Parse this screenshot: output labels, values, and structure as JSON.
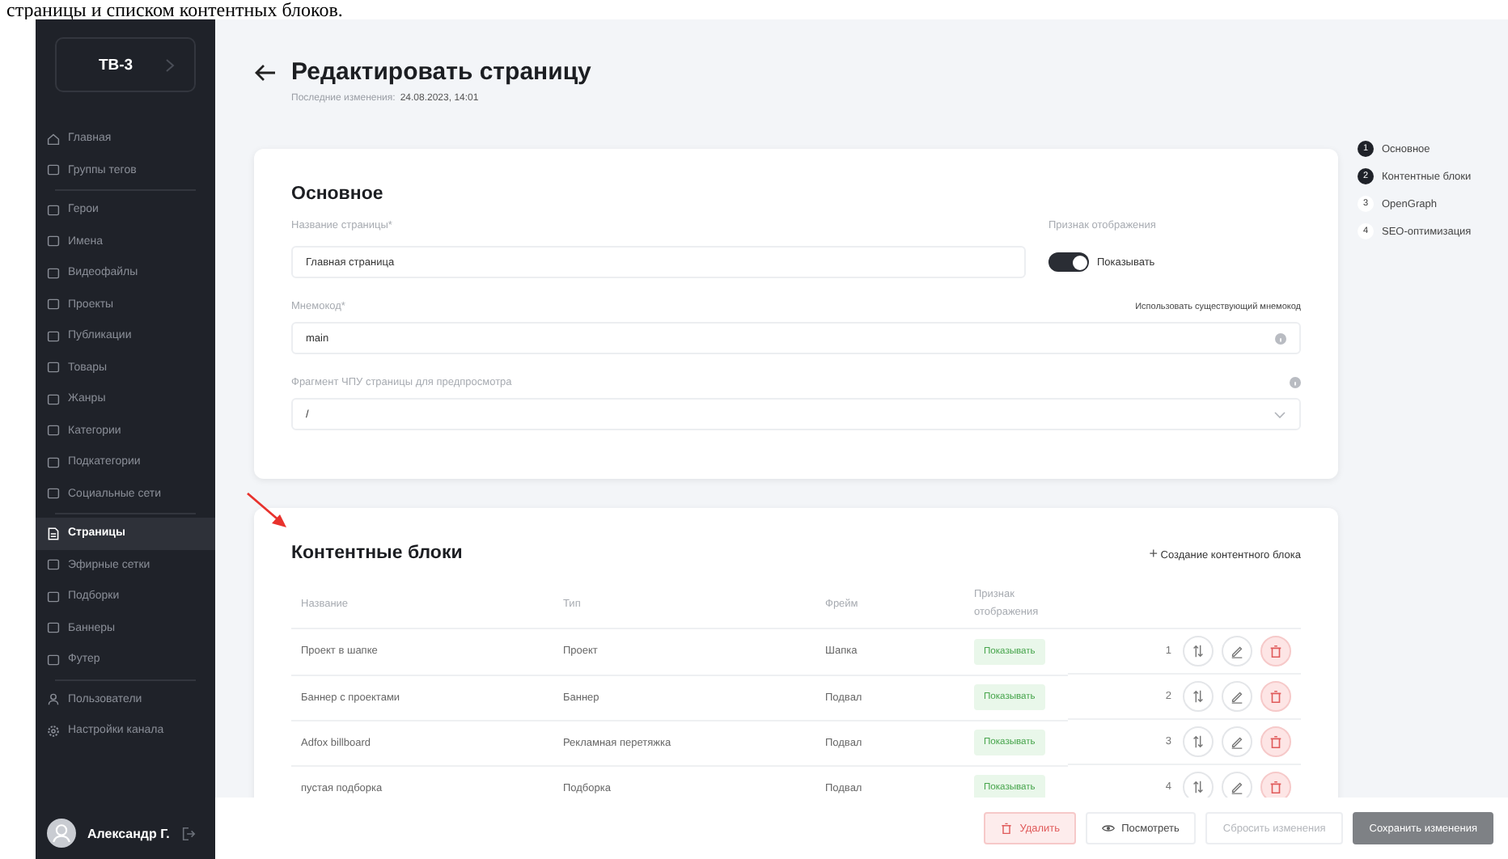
{
  "doc_caption": "страницы и списком контентных блоков.",
  "sidebar": {
    "project": "ТВ-3",
    "groups": [
      [
        {
          "label": "Главная",
          "selected": false
        },
        {
          "label": "Группы тегов",
          "selected": false
        }
      ],
      [
        {
          "label": "Герои",
          "selected": false
        },
        {
          "label": "Имена",
          "selected": false
        },
        {
          "label": "Видеофайлы",
          "selected": false
        },
        {
          "label": "Проекты",
          "selected": false
        },
        {
          "label": "Публикации",
          "selected": false
        },
        {
          "label": "Товары",
          "selected": false
        },
        {
          "label": "Жанры",
          "selected": false
        },
        {
          "label": "Категории",
          "selected": false
        },
        {
          "label": "Подкатегории",
          "selected": false
        },
        {
          "label": "Социальные сети",
          "selected": false
        }
      ],
      [
        {
          "label": "Страницы",
          "selected": true
        },
        {
          "label": "Эфирные сетки",
          "selected": false
        },
        {
          "label": "Подборки",
          "selected": false
        },
        {
          "label": "Баннеры",
          "selected": false
        },
        {
          "label": "Футер",
          "selected": false
        }
      ],
      [
        {
          "label": "Пользователи",
          "selected": false
        },
        {
          "label": "Настройки канала",
          "selected": false
        }
      ]
    ],
    "user": "Александр Г."
  },
  "header": {
    "title": "Редактировать страницу",
    "updated_label": "Последние изменения:",
    "updated_value": "24.08.2023, 14:01"
  },
  "basic": {
    "title": "Основное",
    "name_label": "Название страницы*",
    "name_value": "Главная страница",
    "display_label": "Признак отображения",
    "display_on": true,
    "display_text": "Показывать",
    "code_label": "Мнемокод*",
    "code_link": "Использовать существующий мнемокод",
    "code_value": "main",
    "slug_label": "Фрагмент ЧПУ страницы для предпросмотра",
    "slug_value": "/"
  },
  "blocks": {
    "title": "Контентные блоки",
    "create": "Создание контентного блока",
    "plus": "+",
    "columns": [
      "Название",
      "Тип",
      "Фрейм",
      "Признак отображения"
    ],
    "rows": [
      {
        "name": "Проект в шапке",
        "type": "Проект",
        "frame": "Шапка",
        "display": "Показывать",
        "order": "1"
      },
      {
        "name": "Баннер с проектами",
        "type": "Баннер",
        "frame": "Подвал",
        "display": "Показывать",
        "order": "2"
      },
      {
        "name": "Adfox billboard",
        "type": "Рекламная перетяжка",
        "frame": "Подвал",
        "display": "Показывать",
        "order": "3"
      },
      {
        "name": "пустая подборка",
        "type": "Подборка",
        "frame": "Подвал",
        "display": "Показывать",
        "order": "4"
      }
    ]
  },
  "steps": [
    {
      "number": "1",
      "label": "Основное",
      "done": true
    },
    {
      "number": "2",
      "label": "Контентные блоки",
      "done": true
    },
    {
      "number": "3",
      "label": "OpenGraph",
      "done": false
    },
    {
      "number": "4",
      "label": "SEO-оптимизация",
      "done": false
    }
  ],
  "footer": {
    "delete": "Удалить",
    "view": "Посмотреть",
    "reset": "Сбросить изменения",
    "save": "Сохранить изменения"
  }
}
